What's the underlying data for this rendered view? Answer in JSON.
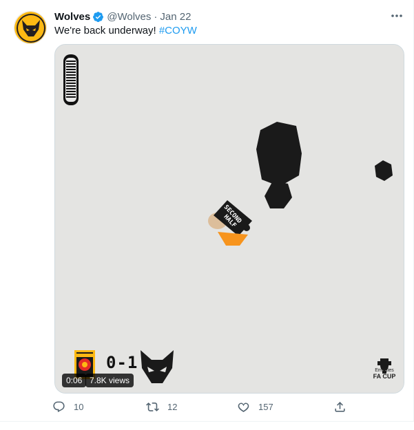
{
  "tweet": {
    "author_name": "Wolves",
    "author_handle": "@Wolves",
    "separator": "·",
    "date": "Jan 22",
    "text": "We're back underway! ",
    "hashtag": "#COYW",
    "more_icon": "more-horizontal-icon",
    "verified_icon": "verified-badge-icon"
  },
  "media": {
    "score": "0-1",
    "video_time": "0:06",
    "views": "7.8K views",
    "cup_line1": "Emirates",
    "cup_line2": "FA CUP",
    "sticker_text": "SECOND HALF",
    "colors": {
      "orange": "#f7941d",
      "black": "#1a1a1a",
      "background": "#e4e4e2"
    }
  },
  "actions": {
    "reply_count": "10",
    "retweet_count": "12",
    "like_count": "157",
    "reply_icon": "reply-icon",
    "retweet_icon": "retweet-icon",
    "like_icon": "heart-icon",
    "share_icon": "share-icon"
  }
}
